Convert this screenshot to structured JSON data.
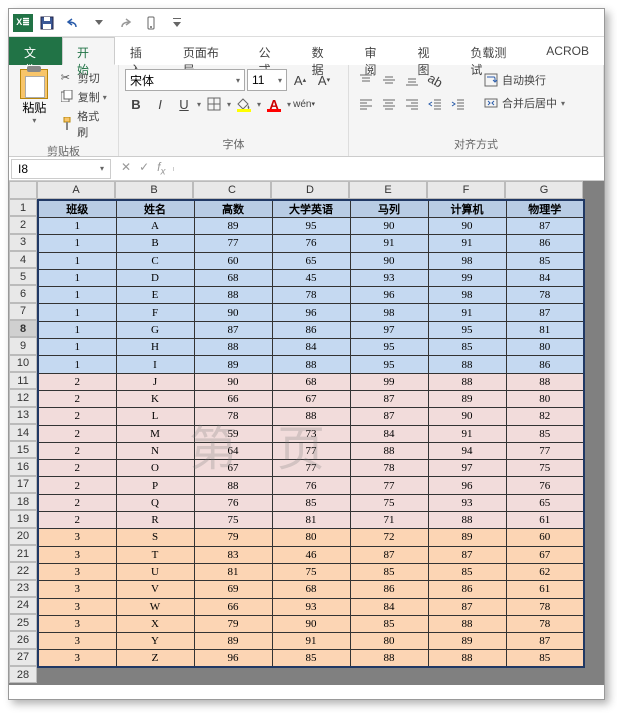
{
  "qat": {
    "save": "保存",
    "undo": "撤销",
    "redo": "重做"
  },
  "tabs": {
    "file": "文件",
    "home": "开始",
    "insert": "插入",
    "layout": "页面布局",
    "formulas": "公式",
    "data": "数据",
    "review": "审阅",
    "view": "视图",
    "loadtest": "负载测试",
    "acrobat": "ACROB"
  },
  "ribbon": {
    "clipboard": {
      "label": "剪贴板",
      "paste": "粘贴",
      "cut": "剪切",
      "copy": "复制",
      "format_painter": "格式刷"
    },
    "font": {
      "label": "字体",
      "name": "宋体",
      "size": "11",
      "bold": "B",
      "italic": "I",
      "underline": "U"
    },
    "alignment": {
      "label": "对齐方式",
      "wrap": "自动换行",
      "merge": "合并后居中"
    }
  },
  "namebox": "I8",
  "watermark": "第页",
  "columns": [
    "A",
    "B",
    "C",
    "D",
    "E",
    "F",
    "G"
  ],
  "chart_data": {
    "type": "table",
    "headers": [
      "班级",
      "姓名",
      "高数",
      "大学英语",
      "马列",
      "计算机",
      "物理学"
    ],
    "rows": [
      {
        "g": 1,
        "cells": [
          "1",
          "A",
          "89",
          "95",
          "90",
          "90",
          "87"
        ]
      },
      {
        "g": 1,
        "cells": [
          "1",
          "B",
          "77",
          "76",
          "91",
          "91",
          "86"
        ]
      },
      {
        "g": 1,
        "cells": [
          "1",
          "C",
          "60",
          "65",
          "90",
          "98",
          "85"
        ]
      },
      {
        "g": 1,
        "cells": [
          "1",
          "D",
          "68",
          "45",
          "93",
          "99",
          "84"
        ]
      },
      {
        "g": 1,
        "cells": [
          "1",
          "E",
          "88",
          "78",
          "96",
          "98",
          "78"
        ]
      },
      {
        "g": 1,
        "cells": [
          "1",
          "F",
          "90",
          "96",
          "98",
          "91",
          "87"
        ]
      },
      {
        "g": 1,
        "cells": [
          "1",
          "G",
          "87",
          "86",
          "97",
          "95",
          "81"
        ]
      },
      {
        "g": 1,
        "cells": [
          "1",
          "H",
          "88",
          "84",
          "95",
          "85",
          "80"
        ]
      },
      {
        "g": 1,
        "cells": [
          "1",
          "I",
          "89",
          "88",
          "95",
          "88",
          "86"
        ]
      },
      {
        "g": 2,
        "cells": [
          "2",
          "J",
          "90",
          "68",
          "99",
          "88",
          "88"
        ]
      },
      {
        "g": 2,
        "cells": [
          "2",
          "K",
          "66",
          "67",
          "87",
          "89",
          "80"
        ]
      },
      {
        "g": 2,
        "cells": [
          "2",
          "L",
          "78",
          "88",
          "87",
          "90",
          "82"
        ]
      },
      {
        "g": 2,
        "cells": [
          "2",
          "M",
          "59",
          "73",
          "84",
          "91",
          "85"
        ]
      },
      {
        "g": 2,
        "cells": [
          "2",
          "N",
          "64",
          "77",
          "88",
          "94",
          "77"
        ]
      },
      {
        "g": 2,
        "cells": [
          "2",
          "O",
          "67",
          "77",
          "78",
          "97",
          "75"
        ]
      },
      {
        "g": 2,
        "cells": [
          "2",
          "P",
          "88",
          "76",
          "77",
          "96",
          "76"
        ]
      },
      {
        "g": 2,
        "cells": [
          "2",
          "Q",
          "76",
          "85",
          "75",
          "93",
          "65"
        ]
      },
      {
        "g": 2,
        "cells": [
          "2",
          "R",
          "75",
          "81",
          "71",
          "88",
          "61"
        ]
      },
      {
        "g": 3,
        "cells": [
          "3",
          "S",
          "79",
          "80",
          "72",
          "89",
          "60"
        ]
      },
      {
        "g": 3,
        "cells": [
          "3",
          "T",
          "83",
          "46",
          "87",
          "87",
          "67"
        ]
      },
      {
        "g": 3,
        "cells": [
          "3",
          "U",
          "81",
          "75",
          "85",
          "85",
          "62"
        ]
      },
      {
        "g": 3,
        "cells": [
          "3",
          "V",
          "69",
          "68",
          "86",
          "86",
          "61"
        ]
      },
      {
        "g": 3,
        "cells": [
          "3",
          "W",
          "66",
          "93",
          "84",
          "87",
          "78"
        ]
      },
      {
        "g": 3,
        "cells": [
          "3",
          "X",
          "79",
          "90",
          "85",
          "88",
          "78"
        ]
      },
      {
        "g": 3,
        "cells": [
          "3",
          "Y",
          "89",
          "91",
          "80",
          "89",
          "87"
        ]
      },
      {
        "g": 3,
        "cells": [
          "3",
          "Z",
          "96",
          "85",
          "88",
          "88",
          "85"
        ]
      }
    ]
  },
  "row_numbers": [
    1,
    2,
    3,
    4,
    5,
    6,
    7,
    8,
    9,
    10,
    11,
    12,
    13,
    14,
    15,
    16,
    17,
    18,
    19,
    20,
    21,
    22,
    23,
    24,
    25,
    26,
    27,
    28
  ],
  "selected_row": 8
}
